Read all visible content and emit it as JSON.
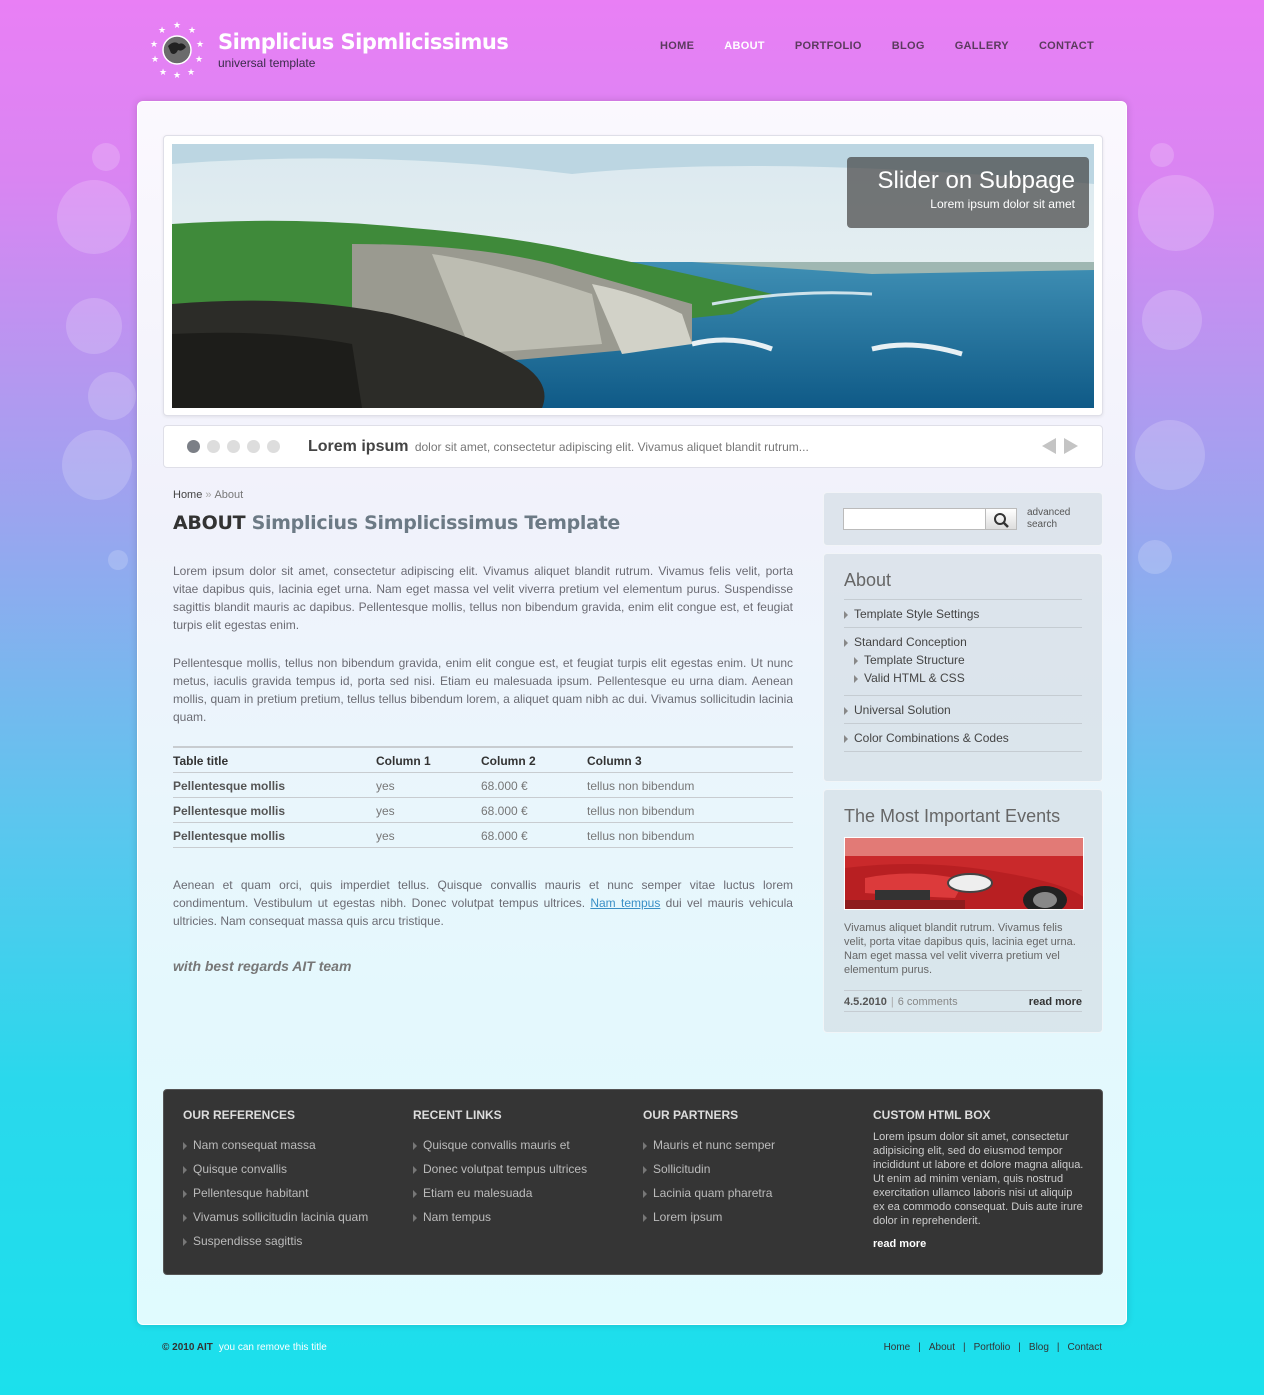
{
  "header": {
    "title": "Simplicius Sipmlicissimus",
    "subtitle": "universal template",
    "nav": [
      "HOME",
      "ABOUT",
      "PORTFOLIO",
      "BLOG",
      "GALLERY",
      "CONTACT"
    ],
    "active_nav": "ABOUT"
  },
  "slider": {
    "caption_title": "Slider on Subpage",
    "caption_sub": "Lorem ipsum dolor sit amet",
    "bar_title": "Lorem ipsum",
    "bar_text": "dolor sit amet, consectetur adipiscing elit. Vivamus aliquet blandit rutrum...",
    "slide_count": 5,
    "active_slide": 1
  },
  "breadcrumb": {
    "home": "Home",
    "separator": "»",
    "current": "About"
  },
  "page": {
    "title_strong": "ABOUT",
    "title_rest": "Simplicius Simplicissimus Template",
    "para1": "Lorem ipsum dolor sit amet, consectetur adipiscing elit. Vivamus aliquet blandit rutrum. Vivamus felis velit, porta vitae dapibus quis, lacinia eget urna. Nam eget massa vel velit viverra pretium vel elementum purus. Suspendisse sagittis blandit mauris ac dapibus. Pellentesque mollis, tellus non bibendum gravida, enim elit congue est, et feugiat turpis elit egestas enim.",
    "para2": "Pellentesque mollis, tellus non bibendum gravida, enim elit congue est, et feugiat turpis elit egestas enim. Ut nunc metus, iaculis gravida tempus id, porta sed nisi. Etiam eu malesuada ipsum. Pellentesque eu urna diam. Aenean mollis, quam in pretium pretium, tellus tellus bibendum lorem, a aliquet quam nibh ac dui. Vivamus sollicitudin lacinia quam.",
    "para3_a": "Aenean et quam orci, quis imperdiet tellus. Quisque convallis mauris et nunc semper vitae luctus lorem condimentum. Vestibulum ut egestas nibh. Donec volutpat tempus ultrices.",
    "para3_link": "Nam tempus",
    "para3_b": "dui vel mauris vehicula ultricies. Nam consequat massa quis arcu tristique.",
    "regards": "with best regards AIT team"
  },
  "table": {
    "headers": [
      "Table title",
      "Column 1",
      "Column 2",
      "Column 3"
    ],
    "rows": [
      [
        "Pellentesque mollis",
        "yes",
        "68.000 €",
        "tellus non bibendum"
      ],
      [
        "Pellentesque mollis",
        "yes",
        "68.000 €",
        "tellus non bibendum"
      ],
      [
        "Pellentesque mollis",
        "yes",
        "68.000 €",
        "tellus non bibendum"
      ]
    ]
  },
  "search": {
    "placeholder": "",
    "advanced_line1": "advanced",
    "advanced_line2": "search"
  },
  "sidebar_about": {
    "title": "About",
    "items": [
      "Template Style Settings",
      "Standard Conception",
      "Universal Solution",
      "Color Combinations & Codes"
    ],
    "subitems": [
      "Template Structure",
      "Valid HTML & CSS"
    ]
  },
  "events": {
    "title": "The Most Important Events",
    "text": "Vivamus aliquet blandit rutrum. Vivamus felis velit, porta vitae dapibus quis, lacinia eget urna. Nam eget massa vel velit viverra pretium vel elementum purus.",
    "date": "4.5.2010",
    "separator": "|",
    "comments": "6 comments",
    "read_more": "read more"
  },
  "footer": {
    "references": {
      "title": "OUR REFERENCES",
      "links": [
        "Nam consequat massa",
        "Quisque convallis",
        "Pellentesque habitant",
        "Vivamus sollicitudin lacinia quam",
        "Suspendisse sagittis"
      ]
    },
    "recent": {
      "title": "RECENT LINKS",
      "links": [
        "Quisque convallis mauris et",
        "Donec volutpat tempus ultrices",
        "Etiam eu malesuada",
        "Nam tempus"
      ]
    },
    "partners": {
      "title": "OUR PARTNERS",
      "links": [
        "Mauris et nunc semper",
        "Sollicitudin",
        "Lacinia quam pharetra",
        "Lorem ipsum"
      ]
    },
    "custom": {
      "title": "CUSTOM HTML BOX",
      "text": "Lorem ipsum dolor sit amet, consectetur adipisicing elit, sed do eiusmod tempor incididunt ut labore et dolore magna aliqua. Ut enim ad minim veniam, quis nostrud exercitation ullamco laboris nisi ut aliquip ex ea commodo consequat. Duis aute irure dolor in reprehenderit.",
      "read_more": "read more"
    }
  },
  "bottom": {
    "copyright": "© 2010 AIT",
    "remove": "you can remove this title",
    "nav": [
      "Home",
      "About",
      "Portfolio",
      "Blog",
      "Contact"
    ],
    "separator": "|"
  }
}
